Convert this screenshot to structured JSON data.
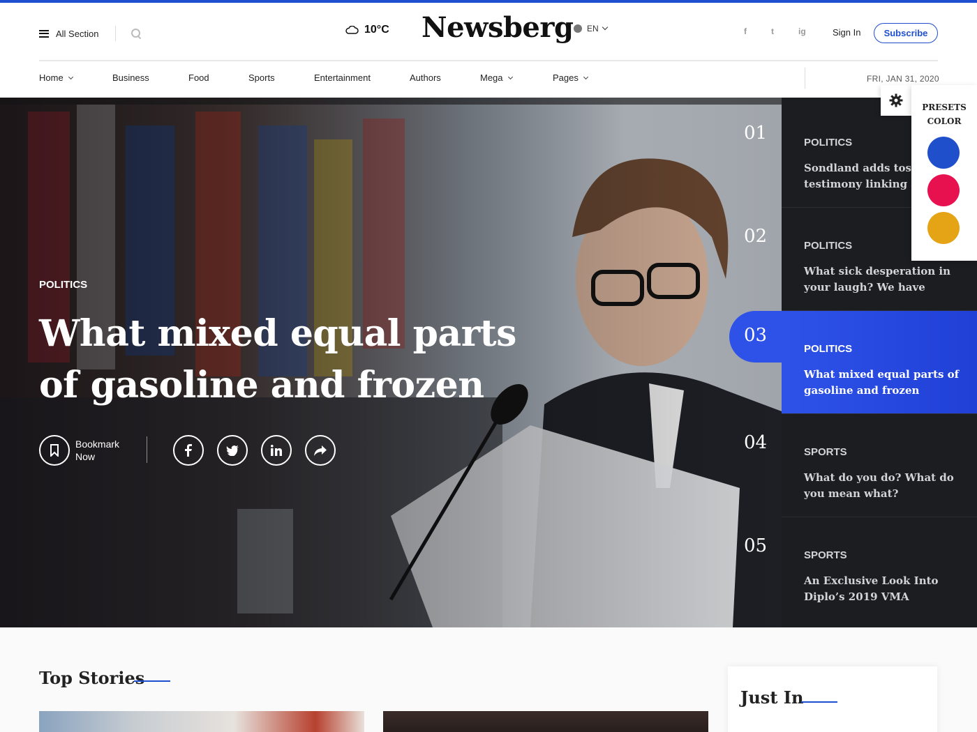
{
  "header": {
    "all_section": "All Section",
    "weather_temp": "10°C",
    "logo": "Newsberg",
    "language": "EN",
    "social": [
      "f",
      "t",
      "ig"
    ],
    "sign_in": "Sign In",
    "subscribe": "Subscribe",
    "date": "FRI, JAN 31, 2020"
  },
  "nav": {
    "items": [
      {
        "label": "Home",
        "dropdown": true
      },
      {
        "label": "Business",
        "dropdown": false
      },
      {
        "label": "Food",
        "dropdown": false
      },
      {
        "label": "Sports",
        "dropdown": false
      },
      {
        "label": "Entertainment",
        "dropdown": false
      },
      {
        "label": "Authors",
        "dropdown": false
      },
      {
        "label": "Mega",
        "dropdown": true
      },
      {
        "label": "Pages",
        "dropdown": true
      }
    ]
  },
  "hero": {
    "category": "POLITICS",
    "title": "What mixed equal parts of gasoline and frozen",
    "bookmark_line1": "Bookmark",
    "bookmark_line2": "Now",
    "share_icons": [
      "facebook-icon",
      "twitter-icon",
      "linkedin-icon",
      "share-icon"
    ]
  },
  "stories": [
    {
      "num": "01",
      "category": "POLITICS",
      "title": "Sondland adds tos testimony linking aid"
    },
    {
      "num": "02",
      "category": "POLITICS",
      "title": "What sick desperation in your laugh? We have"
    },
    {
      "num": "03",
      "category": "POLITICS",
      "title": "What mixed equal parts of gasoline and frozen",
      "active": true
    },
    {
      "num": "04",
      "category": "SPORTS",
      "title": "What do you do? What do you mean what?"
    },
    {
      "num": "05",
      "category": "SPORTS",
      "title": "An Exclusive Look Into Diplo’s 2019 VMA"
    }
  ],
  "presets": {
    "title_line1": "PRESETS",
    "title_line2": "COLOR",
    "colors": [
      "#1f4fcb",
      "#e8114f",
      "#e5a316"
    ]
  },
  "sections": {
    "top_stories": "Top Stories",
    "just_in": "Just In"
  },
  "colors": {
    "accent": "#1e4fcf",
    "active_story": "#2e52e8",
    "dark_panel": "#1c1d21"
  }
}
